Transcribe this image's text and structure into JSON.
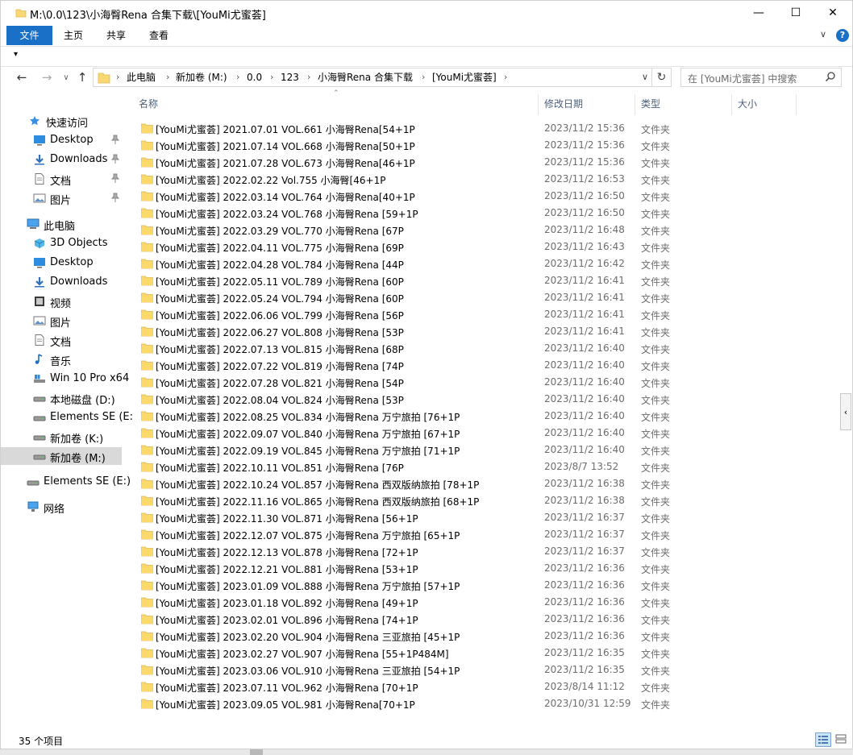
{
  "window": {
    "title": "M:\\0.0\\123\\小海臀Rena 合集下载\\[YouMi尤蜜荟]",
    "minimize": "—",
    "maximize": "☐",
    "close": "✕"
  },
  "ribbon": {
    "tabs": [
      "文件",
      "主页",
      "共享",
      "查看"
    ],
    "collapse": "∨",
    "help": "?"
  },
  "qat": {
    "arrow": "▾"
  },
  "nav": {
    "back": "←",
    "forward": "→",
    "recent": "∨",
    "up": "↑",
    "breadcrumbs": [
      "此电脑",
      "新加卷 (M:)",
      "0.0",
      "123",
      "小海臀Rena 合集下载",
      "[YouMi尤蜜荟]"
    ],
    "separator": "›",
    "address_dropdown": "∨",
    "refresh": "↻",
    "search_placeholder": "在 [YouMi尤蜜荟] 中搜索"
  },
  "sidebar": {
    "items": [
      {
        "label": "快速访问",
        "icon": "star-icon",
        "pinned": false,
        "selected": false
      },
      {
        "label": "Desktop",
        "icon": "desktop-icon",
        "pinned": true,
        "selected": false
      },
      {
        "label": "Downloads",
        "icon": "download-icon",
        "pinned": true,
        "selected": false
      },
      {
        "label": "文档",
        "icon": "document-icon",
        "pinned": true,
        "selected": false
      },
      {
        "label": "图片",
        "icon": "picture-icon",
        "pinned": true,
        "selected": false
      },
      {
        "label": "此电脑",
        "icon": "computer-icon",
        "pinned": false,
        "selected": false
      },
      {
        "label": "3D Objects",
        "icon": "cube-icon",
        "pinned": false,
        "selected": false
      },
      {
        "label": "Desktop",
        "icon": "desktop-icon",
        "pinned": false,
        "selected": false
      },
      {
        "label": "Downloads",
        "icon": "download-icon",
        "pinned": false,
        "selected": false
      },
      {
        "label": "视频",
        "icon": "video-icon",
        "pinned": false,
        "selected": false
      },
      {
        "label": "图片",
        "icon": "picture-icon",
        "pinned": false,
        "selected": false
      },
      {
        "label": "文档",
        "icon": "document-icon",
        "pinned": false,
        "selected": false
      },
      {
        "label": "音乐",
        "icon": "music-icon",
        "pinned": false,
        "selected": false
      },
      {
        "label": "Win 10 Pro x64",
        "icon": "system-drive-icon",
        "pinned": false,
        "selected": false
      },
      {
        "label": "本地磁盘 (D:)",
        "icon": "drive-icon",
        "pinned": false,
        "selected": false
      },
      {
        "label": "Elements SE (E:",
        "icon": "drive-icon",
        "pinned": false,
        "selected": false
      },
      {
        "label": "新加卷 (K:)",
        "icon": "drive-icon",
        "pinned": false,
        "selected": false
      },
      {
        "label": "新加卷 (M:)",
        "icon": "drive-icon",
        "pinned": false,
        "selected": true
      },
      {
        "label": "Elements SE (E:)",
        "icon": "drive-icon",
        "pinned": false,
        "selected": false
      },
      {
        "label": "网络",
        "icon": "network-icon",
        "pinned": false,
        "selected": false
      }
    ],
    "pin_glyph": "📌"
  },
  "columns": [
    "名称",
    "修改日期",
    "类型",
    "大小"
  ],
  "sort_indicator": "⌃",
  "files": [
    {
      "name": "[YouMi尤蜜荟] 2021.07.01 VOL.661 小海臀Rena[54+1P",
      "date": "2023/11/2 15:36",
      "type": "文件夹"
    },
    {
      "name": "[YouMi尤蜜荟] 2021.07.14 VOL.668 小海臀Rena[50+1P",
      "date": "2023/11/2 15:36",
      "type": "文件夹"
    },
    {
      "name": "[YouMi尤蜜荟] 2021.07.28 VOL.673 小海臀Rena[46+1P",
      "date": "2023/11/2 15:36",
      "type": "文件夹"
    },
    {
      "name": "[YouMi尤蜜荟] 2022.02.22 Vol.755 小海臀[46+1P",
      "date": "2023/11/2 16:53",
      "type": "文件夹"
    },
    {
      "name": "[YouMi尤蜜荟] 2022.03.14 VOL.764 小海臀Rena[40+1P",
      "date": "2023/11/2 16:50",
      "type": "文件夹"
    },
    {
      "name": "[YouMi尤蜜荟] 2022.03.24 VOL.768 小海臀Rena [59+1P",
      "date": "2023/11/2 16:50",
      "type": "文件夹"
    },
    {
      "name": "[YouMi尤蜜荟] 2022.03.29 VOL.770 小海臀Rena [67P",
      "date": "2023/11/2 16:48",
      "type": "文件夹"
    },
    {
      "name": "[YouMi尤蜜荟] 2022.04.11 VOL.775 小海臀Rena [69P",
      "date": "2023/11/2 16:43",
      "type": "文件夹"
    },
    {
      "name": "[YouMi尤蜜荟] 2022.04.28 VOL.784 小海臀Rena [44P",
      "date": "2023/11/2 16:42",
      "type": "文件夹"
    },
    {
      "name": "[YouMi尤蜜荟] 2022.05.11 VOL.789 小海臀Rena [60P",
      "date": "2023/11/2 16:41",
      "type": "文件夹"
    },
    {
      "name": "[YouMi尤蜜荟] 2022.05.24 VOL.794 小海臀Rena [60P",
      "date": "2023/11/2 16:41",
      "type": "文件夹"
    },
    {
      "name": "[YouMi尤蜜荟] 2022.06.06 VOL.799 小海臀Rena [56P",
      "date": "2023/11/2 16:41",
      "type": "文件夹"
    },
    {
      "name": "[YouMi尤蜜荟] 2022.06.27 VOL.808 小海臀Rena [53P",
      "date": "2023/11/2 16:41",
      "type": "文件夹"
    },
    {
      "name": "[YouMi尤蜜荟] 2022.07.13 VOL.815 小海臀Rena [68P",
      "date": "2023/11/2 16:40",
      "type": "文件夹"
    },
    {
      "name": "[YouMi尤蜜荟] 2022.07.22 VOL.819 小海臀Rena [74P",
      "date": "2023/11/2 16:40",
      "type": "文件夹"
    },
    {
      "name": "[YouMi尤蜜荟] 2022.07.28 VOL.821 小海臀Rena [54P",
      "date": "2023/11/2 16:40",
      "type": "文件夹"
    },
    {
      "name": "[YouMi尤蜜荟] 2022.08.04 VOL.824 小海臀Rena [53P",
      "date": "2023/11/2 16:40",
      "type": "文件夹"
    },
    {
      "name": "[YouMi尤蜜荟] 2022.08.25 VOL.834 小海臀Rena 万宁旅拍 [76+1P",
      "date": "2023/11/2 16:40",
      "type": "文件夹"
    },
    {
      "name": "[YouMi尤蜜荟] 2022.09.07 VOL.840 小海臀Rena 万宁旅拍 [67+1P",
      "date": "2023/11/2 16:40",
      "type": "文件夹"
    },
    {
      "name": "[YouMi尤蜜荟] 2022.09.19 VOL.845 小海臀Rena 万宁旅拍 [71+1P",
      "date": "2023/11/2 16:40",
      "type": "文件夹"
    },
    {
      "name": "[YouMi尤蜜荟] 2022.10.11 VOL.851 小海臀Rena [76P",
      "date": "2023/8/7 13:52",
      "type": "文件夹"
    },
    {
      "name": "[YouMi尤蜜荟] 2022.10.24 VOL.857 小海臀Rena 西双版纳旅拍 [78+1P",
      "date": "2023/11/2 16:38",
      "type": "文件夹"
    },
    {
      "name": "[YouMi尤蜜荟] 2022.11.16 VOL.865 小海臀Rena 西双版纳旅拍 [68+1P",
      "date": "2023/11/2 16:38",
      "type": "文件夹"
    },
    {
      "name": "[YouMi尤蜜荟] 2022.11.30 VOL.871 小海臀Rena [56+1P",
      "date": "2023/11/2 16:37",
      "type": "文件夹"
    },
    {
      "name": "[YouMi尤蜜荟] 2022.12.07 VOL.875 小海臀Rena 万宁旅拍 [65+1P",
      "date": "2023/11/2 16:37",
      "type": "文件夹"
    },
    {
      "name": "[YouMi尤蜜荟] 2022.12.13 VOL.878 小海臀Rena [72+1P",
      "date": "2023/11/2 16:37",
      "type": "文件夹"
    },
    {
      "name": "[YouMi尤蜜荟] 2022.12.21 VOL.881 小海臀Rena [53+1P",
      "date": "2023/11/2 16:36",
      "type": "文件夹"
    },
    {
      "name": "[YouMi尤蜜荟] 2023.01.09 VOL.888 小海臀Rena 万宁旅拍 [57+1P",
      "date": "2023/11/2 16:36",
      "type": "文件夹"
    },
    {
      "name": "[YouMi尤蜜荟] 2023.01.18 VOL.892 小海臀Rena [49+1P",
      "date": "2023/11/2 16:36",
      "type": "文件夹"
    },
    {
      "name": "[YouMi尤蜜荟] 2023.02.01 VOL.896 小海臀Rena [74+1P",
      "date": "2023/11/2 16:36",
      "type": "文件夹"
    },
    {
      "name": "[YouMi尤蜜荟] 2023.02.20 VOL.904 小海臀Rena 三亚旅拍 [45+1P",
      "date": "2023/11/2 16:36",
      "type": "文件夹"
    },
    {
      "name": "[YouMi尤蜜荟] 2023.02.27 VOL.907 小海臀Rena [55+1P484M]",
      "date": "2023/11/2 16:35",
      "type": "文件夹"
    },
    {
      "name": "[YouMi尤蜜荟] 2023.03.06 VOL.910 小海臀Rena 三亚旅拍 [54+1P",
      "date": "2023/11/2 16:35",
      "type": "文件夹"
    },
    {
      "name": "[YouMi尤蜜荟] 2023.07.11 VOL.962 小海臀Rena [70+1P",
      "date": "2023/8/14 11:12",
      "type": "文件夹"
    },
    {
      "name": "[YouMi尤蜜荟] 2023.09.05 VOL.981 小海臀Rena[70+1P",
      "date": "2023/10/31 12:59",
      "type": "文件夹"
    }
  ],
  "status": {
    "count": "35 个项目"
  },
  "side_tab": "‹",
  "colors": {
    "accent": "#1a6fc7",
    "folder": "#f8d775",
    "folder_dark": "#e0b94a",
    "header_text": "#4c607a",
    "selected": "#d9d9d9"
  }
}
